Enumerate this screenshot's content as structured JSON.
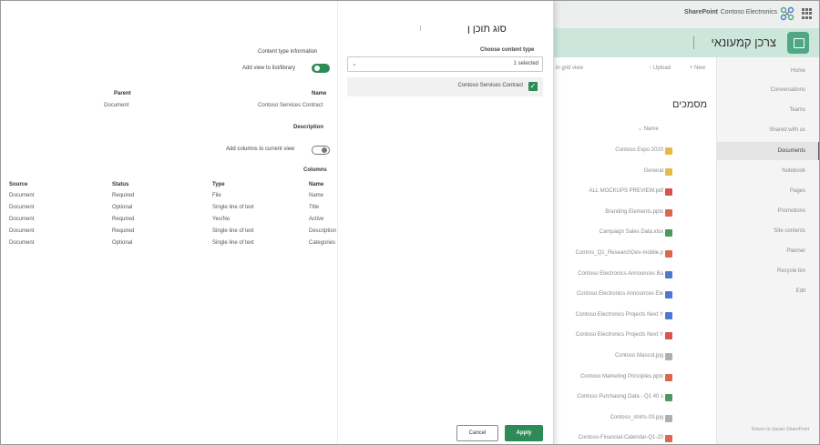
{
  "topbar": {
    "app": "SharePoint",
    "org": "Contoso Electronics"
  },
  "site": {
    "name": "צרכן קמעונאי"
  },
  "nav": {
    "items": [
      "Home",
      "Conversations",
      "Teams",
      "Shared with us",
      "Documents",
      "Notebook",
      "Pages",
      "Promotions",
      "Site contents",
      "Planner",
      "Recycle bin",
      "Edit"
    ],
    "active_index": 4,
    "return_link": "Return to classic SharePoint"
  },
  "commandbar": {
    "new": "New",
    "upload": "Upload",
    "edit_grid": "Edit in grid view"
  },
  "library": {
    "title": "מסמכים",
    "header": "Name",
    "rows": [
      {
        "name": "Contoso Expo 2020",
        "icon": "folder-icon",
        "color": "#e8b84a"
      },
      {
        "name": "General",
        "icon": "folder-icon",
        "color": "#e8b84a"
      },
      {
        "name": "ALL MOCKUPS PREVIEW.pdf",
        "icon": "pdf-icon",
        "color": "#d9534f"
      },
      {
        "name": "Branding Elements.pptx",
        "icon": "powerpoint-icon",
        "color": "#d9684f"
      },
      {
        "name": "Campaign Sales Data.xlsx",
        "icon": "excel-icon",
        "color": "#4a9a5f"
      },
      {
        "name": "Comms_Q1_ResearchDev-mobile.p",
        "icon": "powerpoint-icon",
        "color": "#d9684f"
      },
      {
        "name": "Contoso Electronics Announces Ba",
        "icon": "word-icon",
        "color": "#4a7acb"
      },
      {
        "name": "Contoso Electronics Announces Ele",
        "icon": "word-icon",
        "color": "#4a7acb"
      },
      {
        "name": "Contoso Electronics Projects Next Y",
        "icon": "word-icon",
        "color": "#4a7acb"
      },
      {
        "name": "Contoso Electronics Projects Next Y",
        "icon": "pdf-icon",
        "color": "#d9534f"
      },
      {
        "name": "Contoso Mascot.jpg",
        "icon": "image-icon",
        "color": "#b0b0b0"
      },
      {
        "name": "Contoso Marketing Principles.pptx",
        "icon": "powerpoint-icon",
        "color": "#d9684f"
      },
      {
        "name": "Contoso Purchasing Data - Q1 40 s",
        "icon": "excel-icon",
        "color": "#4a9a5f"
      },
      {
        "name": "Contoso_shirts-03.jpg",
        "icon": "image-icon",
        "color": "#b0b0b0"
      },
      {
        "name": "Contoso-Financial-Calendar-Q1-20",
        "icon": "powerpoint-icon",
        "color": "#d9684f"
      }
    ]
  },
  "panel": {
    "title": "סוג תוכן ן",
    "title_glyph": "׀",
    "choose_label": "Choose content type",
    "select_value": "1 selected",
    "option_label": "Contoso Services Contract",
    "info_title": "Content type information",
    "add_view_label": "Add view to list/library",
    "name_header": "Name",
    "parent_header": "Parent",
    "name_value": "Contoso Services Contract",
    "parent_value": "Document",
    "description_header": "Description",
    "add_columns_label": "Add columns to current view",
    "columns_header": "Columns",
    "col_headers": {
      "name": "Name",
      "type": "Type",
      "status": "Status",
      "source": "Source"
    },
    "columns": [
      {
        "name": "Name",
        "type": "File",
        "status": "Required",
        "source": "Document"
      },
      {
        "name": "Title",
        "type": "Single line of text",
        "status": "Optional",
        "source": "Document"
      },
      {
        "name": "Active",
        "type": "Yes/No",
        "status": "Required",
        "source": "Document"
      },
      {
        "name": "Description",
        "type": "Single line of text",
        "status": "Required",
        "source": "Document"
      },
      {
        "name": "Categories",
        "type": "Single line of text",
        "status": "Optional",
        "source": "Document"
      }
    ],
    "apply": "Apply",
    "cancel": "Cancel"
  },
  "colors": {
    "accent": "#2e8b57",
    "site_band": "#cde6dc"
  }
}
